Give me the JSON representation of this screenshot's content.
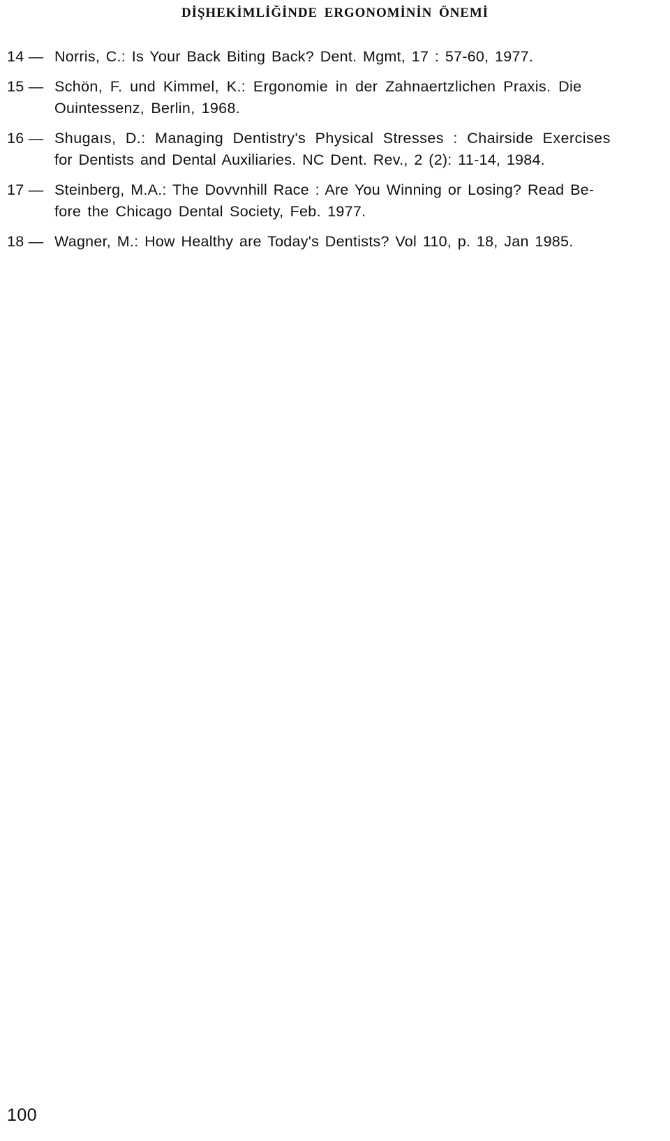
{
  "header": {
    "running_title": "DİŞHEKİMLİĞİNDE ERGONOMİNİN ÖNEMİ"
  },
  "references": [
    {
      "number": "14 —",
      "lines": [
        "Norris, C.: Is Your Back Biting Back? Dent. Mgmt, 17 : 57-60, 1977."
      ]
    },
    {
      "number": "15 —",
      "lines": [
        "Schön, F. und Kimmel, K.: Ergonomie in der Zahnaertzlichen Praxis.  Die",
        "Ouintessenz, Berlin, 1968."
      ]
    },
    {
      "number": "16 —",
      "lines": [
        "Shugaıs, D.: Managing Dentistry's Physical Stresses : Chairside Exercises",
        "for Dentists and Dental Auxiliaries. NC Dent. Rev., 2 (2): 11-14, 1984."
      ]
    },
    {
      "number": "17 —",
      "lines": [
        "Steinberg, M.A.: The Dovvnhill Race : Are You Winning or Losing? Read Be-",
        "fore the Chicago Dental Society, Feb. 1977."
      ]
    },
    {
      "number": "18 —",
      "lines": [
        "Wagner, M.: How Healthy are Today's Dentists? Vol 110, p. 18, Jan 1985."
      ]
    }
  ],
  "footer": {
    "page_number": "100"
  }
}
